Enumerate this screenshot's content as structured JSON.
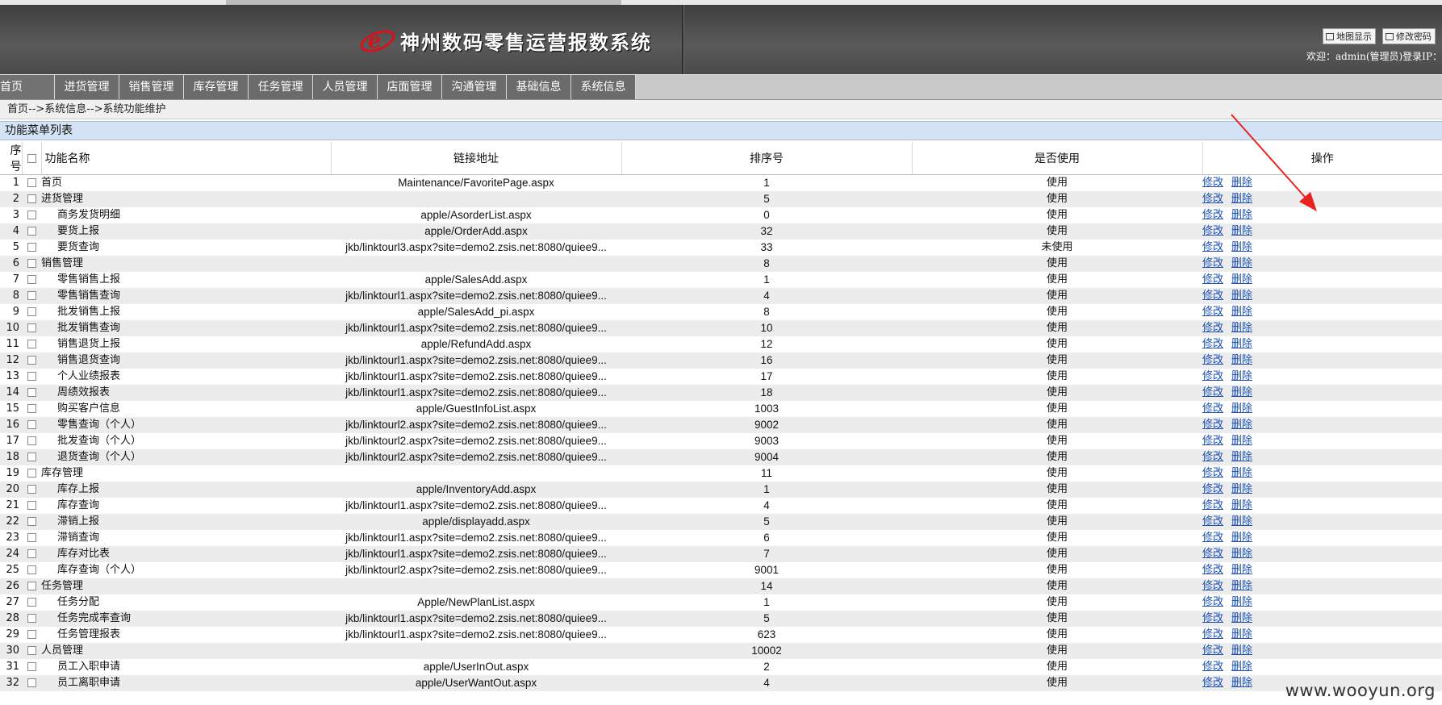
{
  "header": {
    "title": "神州数码零售运营报数系统",
    "map_button": "地图显示",
    "password_button": "修改密码",
    "welcome": "欢迎：admin(管理员)登录IP："
  },
  "nav": [
    "首页",
    "进货管理",
    "销售管理",
    "库存管理",
    "任务管理",
    "人员管理",
    "店面管理",
    "沟通管理",
    "基础信息",
    "系统信息"
  ],
  "breadcrumb": "首页-->系统信息-->系统功能维护",
  "section_title": "功能菜单列表",
  "table": {
    "headers": {
      "no": "序号",
      "name": "功能名称",
      "url": "链接地址",
      "sort": "排序号",
      "use": "是否使用",
      "ops": "操作"
    },
    "edit_label": "修改",
    "delete_label": "删除",
    "rows": [
      {
        "no": "1",
        "name": "首页",
        "child": false,
        "url": "Maintenance/FavoritePage.aspx",
        "sort": "1",
        "use": "使用"
      },
      {
        "no": "2",
        "name": "进货管理",
        "child": false,
        "url": "",
        "sort": "5",
        "use": "使用"
      },
      {
        "no": "3",
        "name": "商务发货明细",
        "child": true,
        "url": "apple/AsorderList.aspx",
        "sort": "0",
        "use": "使用"
      },
      {
        "no": "4",
        "name": "要货上报",
        "child": true,
        "url": "apple/OrderAdd.aspx",
        "sort": "32",
        "use": "使用"
      },
      {
        "no": "5",
        "name": "要货查询",
        "child": true,
        "url": "jkb/linktourl3.aspx?site=demo2.zsis.net:8080/quiee9...",
        "sort": "33",
        "use": "未使用"
      },
      {
        "no": "6",
        "name": "销售管理",
        "child": false,
        "url": "",
        "sort": "8",
        "use": "使用"
      },
      {
        "no": "7",
        "name": "零售销售上报",
        "child": true,
        "url": "apple/SalesAdd.aspx",
        "sort": "1",
        "use": "使用"
      },
      {
        "no": "8",
        "name": "零售销售查询",
        "child": true,
        "url": "jkb/linktourl1.aspx?site=demo2.zsis.net:8080/quiee9...",
        "sort": "4",
        "use": "使用"
      },
      {
        "no": "9",
        "name": "批发销售上报",
        "child": true,
        "url": "apple/SalesAdd_pi.aspx",
        "sort": "8",
        "use": "使用"
      },
      {
        "no": "10",
        "name": "批发销售查询",
        "child": true,
        "url": "jkb/linktourl1.aspx?site=demo2.zsis.net:8080/quiee9...",
        "sort": "10",
        "use": "使用"
      },
      {
        "no": "11",
        "name": "销售退货上报",
        "child": true,
        "url": "apple/RefundAdd.aspx",
        "sort": "12",
        "use": "使用"
      },
      {
        "no": "12",
        "name": "销售退货查询",
        "child": true,
        "url": "jkb/linktourl1.aspx?site=demo2.zsis.net:8080/quiee9...",
        "sort": "16",
        "use": "使用"
      },
      {
        "no": "13",
        "name": "个人业绩报表",
        "child": true,
        "url": "jkb/linktourl1.aspx?site=demo2.zsis.net:8080/quiee9...",
        "sort": "17",
        "use": "使用"
      },
      {
        "no": "14",
        "name": "周绩效报表",
        "child": true,
        "url": "jkb/linktourl1.aspx?site=demo2.zsis.net:8080/quiee9...",
        "sort": "18",
        "use": "使用"
      },
      {
        "no": "15",
        "name": "购买客户信息",
        "child": true,
        "url": "apple/GuestInfoList.aspx",
        "sort": "1003",
        "use": "使用"
      },
      {
        "no": "16",
        "name": "零售查询（个人）",
        "child": true,
        "url": "jkb/linktourl2.aspx?site=demo2.zsis.net:8080/quiee9...",
        "sort": "9002",
        "use": "使用"
      },
      {
        "no": "17",
        "name": "批发查询（个人）",
        "child": true,
        "url": "jkb/linktourl2.aspx?site=demo2.zsis.net:8080/quiee9...",
        "sort": "9003",
        "use": "使用"
      },
      {
        "no": "18",
        "name": "退货查询（个人）",
        "child": true,
        "url": "jkb/linktourl2.aspx?site=demo2.zsis.net:8080/quiee9...",
        "sort": "9004",
        "use": "使用"
      },
      {
        "no": "19",
        "name": "库存管理",
        "child": false,
        "url": "",
        "sort": "11",
        "use": "使用"
      },
      {
        "no": "20",
        "name": "库存上报",
        "child": true,
        "url": "apple/InventoryAdd.aspx",
        "sort": "1",
        "use": "使用"
      },
      {
        "no": "21",
        "name": "库存查询",
        "child": true,
        "url": "jkb/linktourl1.aspx?site=demo2.zsis.net:8080/quiee9...",
        "sort": "4",
        "use": "使用"
      },
      {
        "no": "22",
        "name": "滞销上报",
        "child": true,
        "url": "apple/displayadd.aspx",
        "sort": "5",
        "use": "使用"
      },
      {
        "no": "23",
        "name": "滞销查询",
        "child": true,
        "url": "jkb/linktourl1.aspx?site=demo2.zsis.net:8080/quiee9...",
        "sort": "6",
        "use": "使用"
      },
      {
        "no": "24",
        "name": "库存对比表",
        "child": true,
        "url": "jkb/linktourl1.aspx?site=demo2.zsis.net:8080/quiee9...",
        "sort": "7",
        "use": "使用"
      },
      {
        "no": "25",
        "name": "库存查询（个人）",
        "child": true,
        "url": "jkb/linktourl2.aspx?site=demo2.zsis.net:8080/quiee9...",
        "sort": "9001",
        "use": "使用"
      },
      {
        "no": "26",
        "name": "任务管理",
        "child": false,
        "url": "",
        "sort": "14",
        "use": "使用"
      },
      {
        "no": "27",
        "name": "任务分配",
        "child": true,
        "url": "Apple/NewPlanList.aspx",
        "sort": "1",
        "use": "使用"
      },
      {
        "no": "28",
        "name": "任务完成率查询",
        "child": true,
        "url": "jkb/linktourl1.aspx?site=demo2.zsis.net:8080/quiee9...",
        "sort": "5",
        "use": "使用"
      },
      {
        "no": "29",
        "name": "任务管理报表",
        "child": true,
        "url": "jkb/linktourl1.aspx?site=demo2.zsis.net:8080/quiee9...",
        "sort": "623",
        "use": "使用"
      },
      {
        "no": "30",
        "name": "人员管理",
        "child": false,
        "url": "",
        "sort": "10002",
        "use": "使用"
      },
      {
        "no": "31",
        "name": "员工入职申请",
        "child": true,
        "url": "apple/UserInOut.aspx",
        "sort": "2",
        "use": "使用"
      },
      {
        "no": "32",
        "name": "员工离职申请",
        "child": true,
        "url": "apple/UserWantOut.aspx",
        "sort": "4",
        "use": "使用"
      }
    ]
  },
  "watermark": "www.wooyun.org",
  "colors": {
    "nav_bg": "#6b6b6b",
    "section_bg": "#d3e2f4",
    "link": "#1a4fb8",
    "arrow": "#e8231f"
  }
}
